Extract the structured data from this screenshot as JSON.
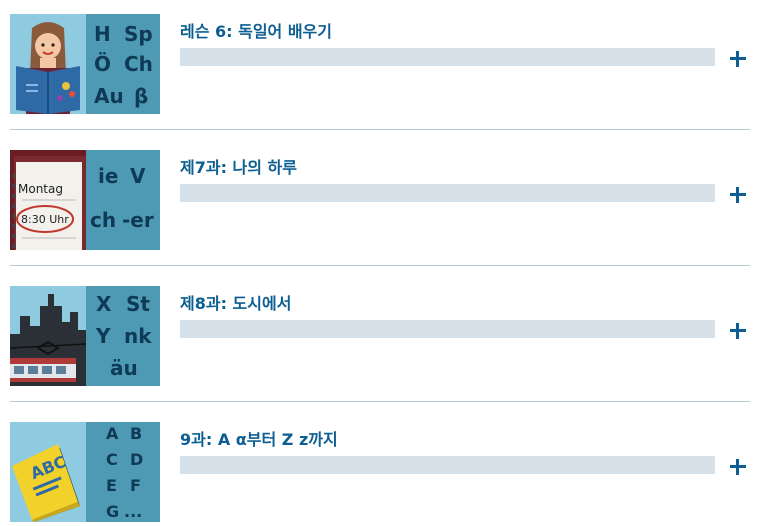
{
  "lessons": [
    {
      "title": "레슨 6: 독일어 배우기",
      "progress": 0,
      "thumbnail": {
        "icon": "girl-reading-book-icon",
        "letters": [
          "H",
          "Sp",
          "Ö",
          "Ch",
          "Au",
          "β"
        ]
      },
      "expand_icon": "plus-icon"
    },
    {
      "title": "제7과: 나의 하루",
      "progress": 0,
      "thumbnail": {
        "icon": "calendar-notepad-icon",
        "note_day": "Montag",
        "note_time": "8:30 Uhr",
        "letters": [
          "ie",
          "V",
          "ch",
          "-er"
        ]
      },
      "expand_icon": "plus-icon"
    },
    {
      "title": "제8과: 도시에서",
      "progress": 0,
      "thumbnail": {
        "icon": "city-tram-icon",
        "letters": [
          "X",
          "St",
          "Y",
          "nk",
          "äu"
        ]
      },
      "expand_icon": "plus-icon"
    },
    {
      "title": "9과: A α부터 Z z까지",
      "progress": 0,
      "thumbnail": {
        "icon": "abc-book-icon",
        "book_text": "ABC",
        "letters": [
          "A",
          "B",
          "C",
          "D",
          "E",
          "F",
          "G",
          "..."
        ]
      },
      "expand_icon": "plus-icon"
    }
  ],
  "colors": {
    "accent": "#0d5e93",
    "track": "#d6e0e8",
    "tile": "#4e9ab4",
    "divider": "#b7c7cf"
  }
}
